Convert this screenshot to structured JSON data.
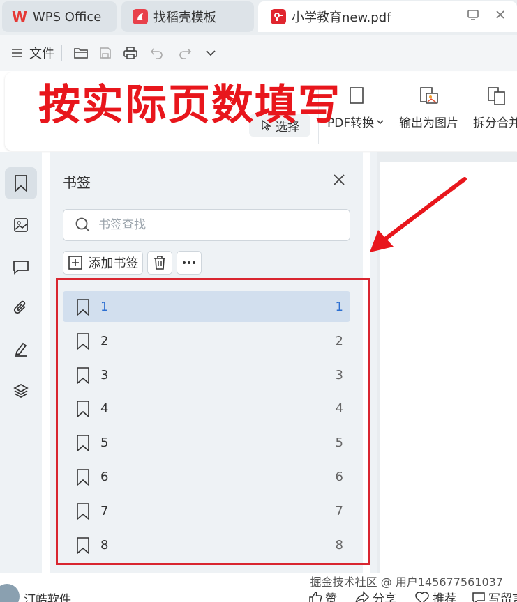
{
  "tabs": [
    {
      "label": "WPS Office",
      "icon": "wps-logo-icon"
    },
    {
      "label": "找稻壳模板",
      "icon": "docer-icon"
    },
    {
      "label": "小学教育new.pdf",
      "icon": "pdf-icon"
    }
  ],
  "toolbar": {
    "file_label": "文件"
  },
  "ribbon": {
    "overlay_text": "按实际页数填写",
    "select_label": "选择",
    "pdf_convert_label": "PDF转换",
    "export_image_label": "输出为图片",
    "split_merge_label": "拆分合并"
  },
  "bookmark_panel": {
    "title": "书签",
    "search_placeholder": "书签查找",
    "add_label": "添加书签",
    "items": [
      {
        "label": "1",
        "page": "1"
      },
      {
        "label": "2",
        "page": "2"
      },
      {
        "label": "3",
        "page": "3"
      },
      {
        "label": "4",
        "page": "4"
      },
      {
        "label": "5",
        "page": "5"
      },
      {
        "label": "6",
        "page": "6"
      },
      {
        "label": "7",
        "page": "7"
      },
      {
        "label": "8",
        "page": "8"
      }
    ]
  },
  "footer": {
    "watermark": "掘金技术社区 @ 用户145677561037",
    "author": "汀皓软件",
    "like_label": "赞",
    "share_label": "分享",
    "recommend_label": "推荐",
    "comment_label": "写留言"
  },
  "colors": {
    "accent_red": "#e8161c",
    "selected_blue": "#2c6fd1",
    "frame_red": "#d92630"
  }
}
